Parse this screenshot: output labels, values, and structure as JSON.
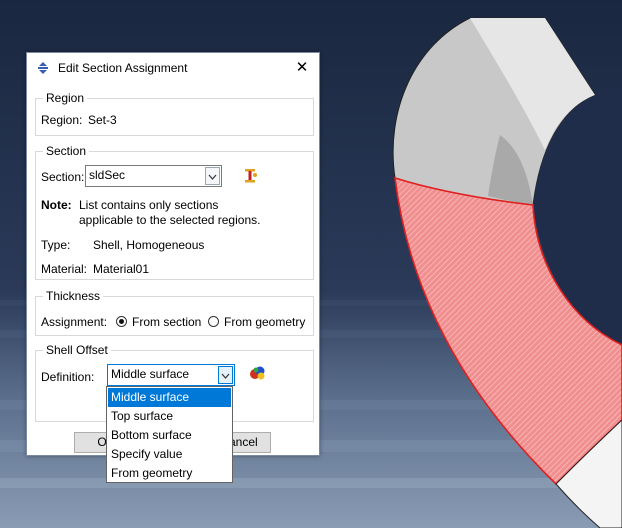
{
  "dialog": {
    "title": "Edit Section Assignment",
    "close_glyph": "✕",
    "region": {
      "group_title": "Region",
      "label": "Region:",
      "value": "Set-3"
    },
    "section": {
      "group_title": "Section",
      "label": "Section:",
      "selected": "sldSec",
      "note_label": "Note:",
      "note_line1": "List contains only sections",
      "note_line2": "applicable to the selected regions.",
      "type_label": "Type:",
      "type_value": "Shell, Homogeneous",
      "material_label": "Material:",
      "material_value": "Material01"
    },
    "thickness": {
      "group_title": "Thickness",
      "assignment_label": "Assignment:",
      "option_section": "From section",
      "option_geometry": "From geometry",
      "selected": "From section"
    },
    "shell_offset": {
      "group_title": "Shell Offset",
      "definition_label": "Definition:",
      "selected": "Middle surface",
      "options": [
        "Middle surface",
        "Top surface",
        "Bottom surface",
        "Specify value",
        "From geometry"
      ]
    },
    "buttons": {
      "ok": "OK",
      "cancel": "Cancel"
    }
  },
  "icons": {
    "title": "section-assign-icon",
    "section_create": "create-section-icon",
    "offset": "shell-offset-icon"
  },
  "colors": {
    "viewport_top": "#1a2740",
    "viewport_bottom": "#8a9cb4",
    "selection_red": "#e02020",
    "selected_option": "#0078d7"
  }
}
